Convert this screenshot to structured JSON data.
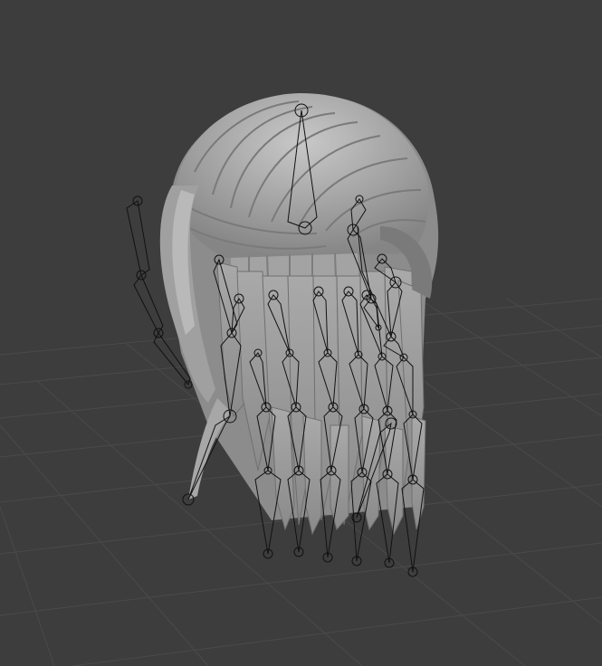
{
  "viewport": {
    "background_color": "#3d3d3d",
    "grid_color": "#4a4a4a",
    "mesh_color": "#9a9a9a",
    "mesh_highlight_color": "#c4c4c4",
    "mesh_shadow_color": "#6e6e6e",
    "armature_color": "#111111",
    "object": "hair-mesh",
    "overlay": "armature-bones"
  }
}
